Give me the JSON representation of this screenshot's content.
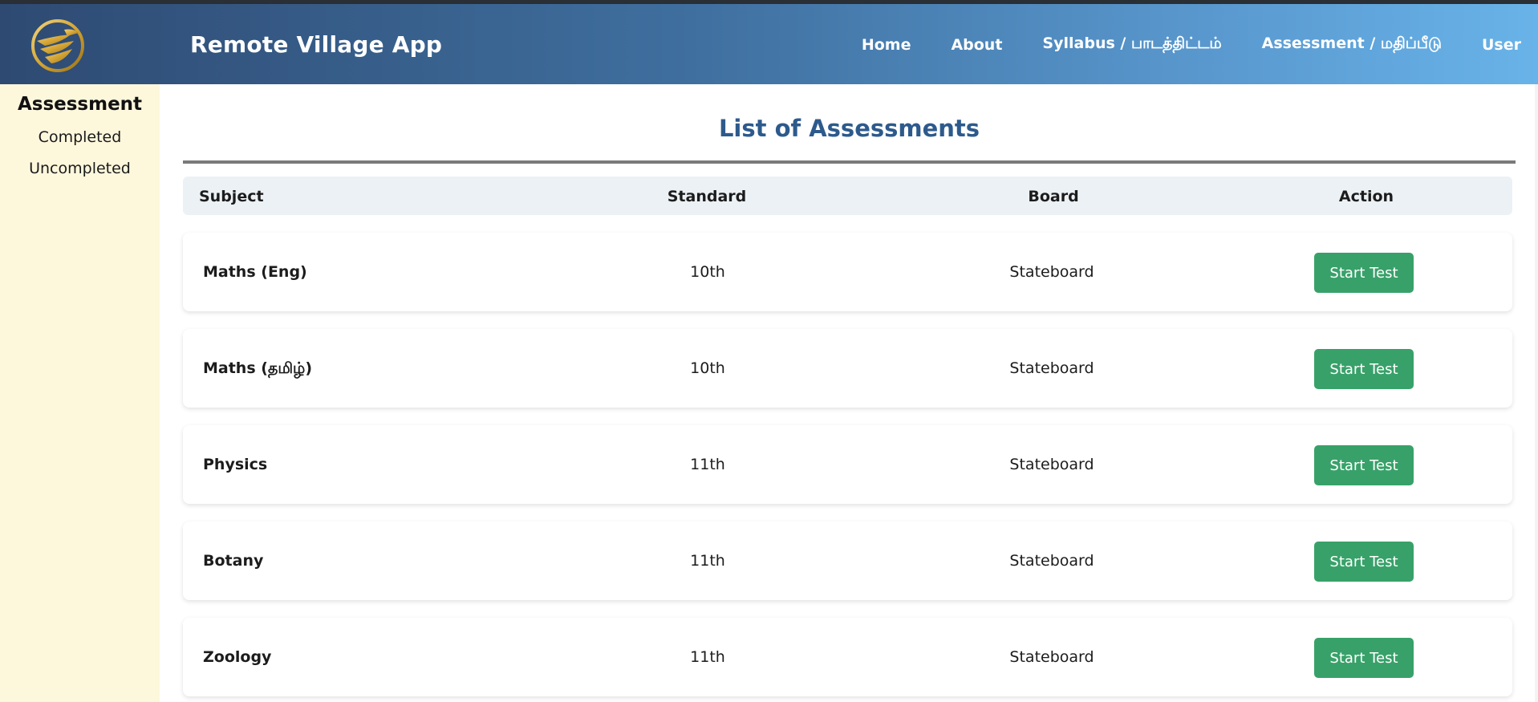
{
  "app": {
    "title": "Remote Village App",
    "logo_icon": "bird-emblem-icon"
  },
  "nav": {
    "items": [
      {
        "label": "Home"
      },
      {
        "label": "About"
      },
      {
        "label": "Syllabus / பாடத்திட்டம்"
      },
      {
        "label": "Assessment / மதிப்பீடு"
      },
      {
        "label": "User"
      }
    ]
  },
  "sidebar": {
    "title": "Assessment",
    "items": [
      {
        "label": "Completed"
      },
      {
        "label": "Uncompleted"
      }
    ]
  },
  "main": {
    "title": "List of Assessments",
    "columns": [
      "Subject",
      "Standard",
      "Board",
      "Action"
    ],
    "rows": [
      {
        "subject": "Maths (Eng)",
        "standard": "10th",
        "board": "Stateboard",
        "action": "Start Test"
      },
      {
        "subject": "Maths (தமிழ்)",
        "standard": "10th",
        "board": "Stateboard",
        "action": "Start Test"
      },
      {
        "subject": "Physics",
        "standard": "11th",
        "board": "Stateboard",
        "action": "Start Test"
      },
      {
        "subject": "Botany",
        "standard": "11th",
        "board": "Stateboard",
        "action": "Start Test"
      },
      {
        "subject": "Zoology",
        "standard": "11th",
        "board": "Stateboard",
        "action": "Start Test"
      }
    ]
  },
  "colors": {
    "nav_gradient_start": "#2e4a72",
    "nav_gradient_end": "#68b3e9",
    "sidebar_bg": "#fdf7dc",
    "title_blue": "#2d5a8c",
    "button_green": "#38a169",
    "header_row_bg": "#ecf1f5"
  }
}
